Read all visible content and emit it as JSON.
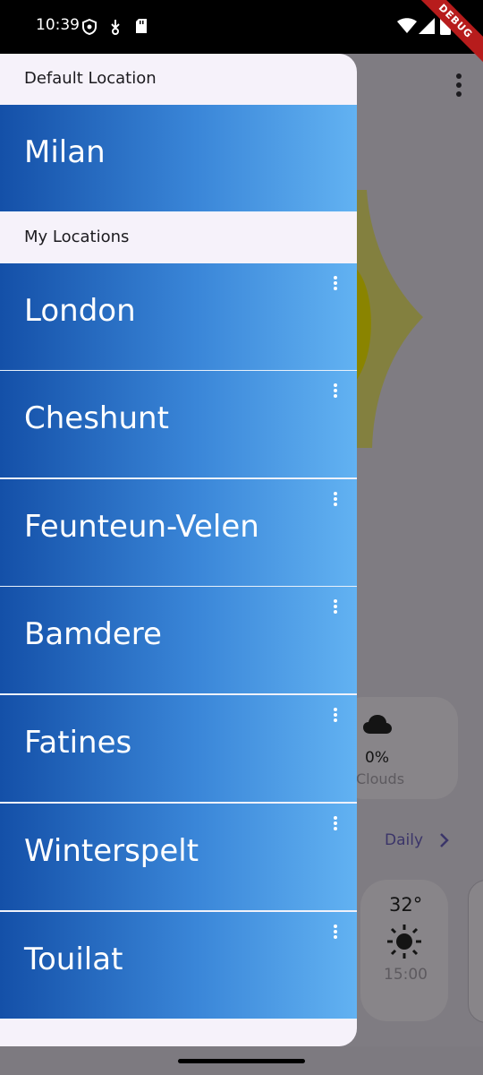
{
  "status_bar": {
    "time": "10:39",
    "debug_label": "DEBUG"
  },
  "drawer": {
    "default_header": "Default Location",
    "default_location": "Milan",
    "my_header": "My Locations",
    "locations": [
      "London",
      "Cheshunt",
      "Feunteun-Velen",
      "Bamdere",
      "Fatines",
      "Winterspelt",
      "Touilat"
    ]
  },
  "background": {
    "clouds_value": "0%",
    "clouds_label": "Clouds",
    "daily_label": "Daily",
    "hourly": [
      {
        "temp": "32°",
        "time": "15:00",
        "icon": "sun-icon"
      }
    ]
  },
  "colors": {
    "gradient_start": "#1450a8",
    "gradient_end": "#62b2f2",
    "drawer_bg": "#f6f2fa",
    "scrim": "#7f7c82"
  }
}
